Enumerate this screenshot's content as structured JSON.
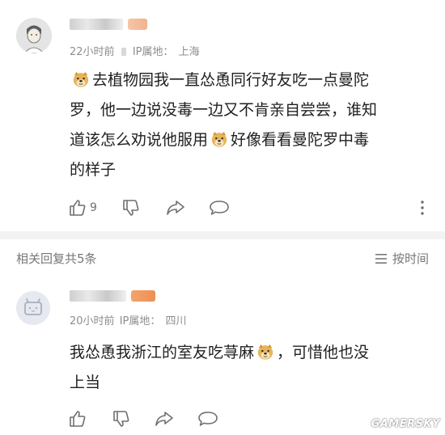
{
  "comment": {
    "time": "22小时前",
    "ip_label": "IP属地：",
    "ip_location": "上海",
    "text_line1": "去植物园我一直怂恿同行好友吃一点曼陀",
    "text_line2": "罗，他一边说没毒一边又不肯亲自尝尝，谁知",
    "text_line3a": "道该怎么劝说他服用",
    "text_line3b": "好像看看曼陀罗中毒",
    "text_line4": "的样子",
    "like_count": "9",
    "icons": [
      "like-icon",
      "dislike-icon",
      "share-icon",
      "reply-icon",
      "more-icon"
    ]
  },
  "replies_header": {
    "count_label": "相关回复共5条",
    "sort_label": "按时间"
  },
  "reply": {
    "time": "20小时前",
    "ip_label": "IP属地：",
    "ip_location": "四川",
    "text_line1a": "我怂恿我浙江的室友吃荨麻",
    "text_line1b": "，可惜他也没",
    "text_line2": "上当",
    "icons": [
      "like-icon",
      "dislike-icon",
      "share-icon",
      "reply-icon"
    ]
  },
  "watermark": "GAMERSKY",
  "colors": {
    "meta": "#8d8d8d",
    "text": "#1f1f1f",
    "divider": "#f3f3f3"
  }
}
